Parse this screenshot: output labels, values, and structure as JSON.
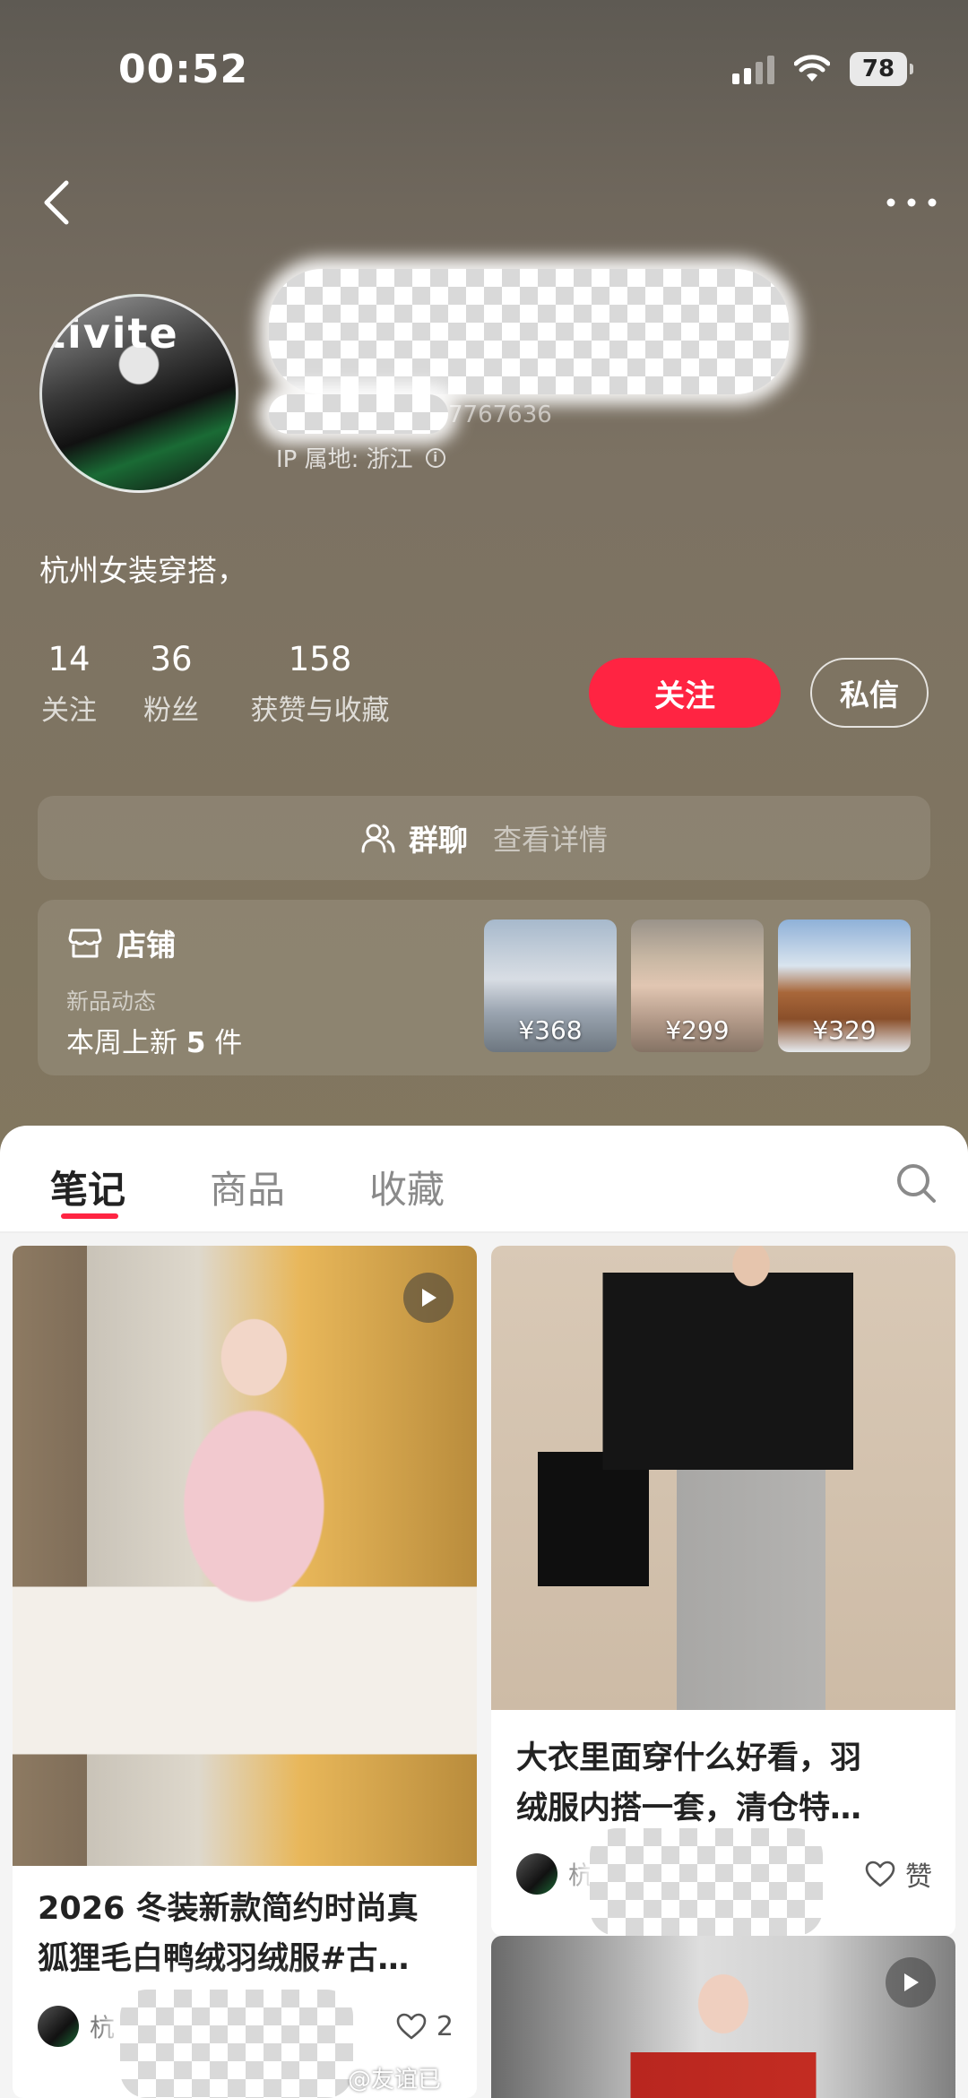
{
  "status_bar": {
    "time": "00:52",
    "battery": "78"
  },
  "profile": {
    "user_id_partial": "7767636",
    "ip_location": "IP 属地: 浙江",
    "bio": "杭州女装穿搭，",
    "avatar_text": "tivite"
  },
  "stats": [
    {
      "value": "14",
      "label": "关注"
    },
    {
      "value": "36",
      "label": "粉丝"
    },
    {
      "value": "158",
      "label": "获赞与收藏"
    }
  ],
  "actions": {
    "follow": "关注",
    "message": "私信"
  },
  "group_chat": {
    "title": "群聊",
    "link": "查看详情"
  },
  "shop": {
    "title": "店铺",
    "subtitle": "新品动态",
    "new_prefix": "本周上新 ",
    "new_count": "5",
    "new_suffix": " 件",
    "products": [
      {
        "price": "¥368"
      },
      {
        "price": "¥299"
      },
      {
        "price": "¥329"
      }
    ]
  },
  "tabs": [
    {
      "label": "笔记",
      "active": true
    },
    {
      "label": "商品",
      "active": false
    },
    {
      "label": "收藏",
      "active": false
    }
  ],
  "notes": [
    {
      "title_line1": "2026 冬装新款简约时尚真",
      "title_line2": "狐狸毛白鸭绒羽绒服#古…",
      "author": "杭",
      "likes": "2",
      "video": true
    },
    {
      "title_line1": "大衣里面穿什么好看，羽",
      "title_line2": "绒服内搭一套，清仓特…",
      "author": "杭",
      "likes": "赞",
      "video": false
    },
    {
      "video": true
    }
  ],
  "watermark": "@友谊已",
  "colors": {
    "accent": "#ff2442",
    "header_bg": "#7c7263"
  }
}
